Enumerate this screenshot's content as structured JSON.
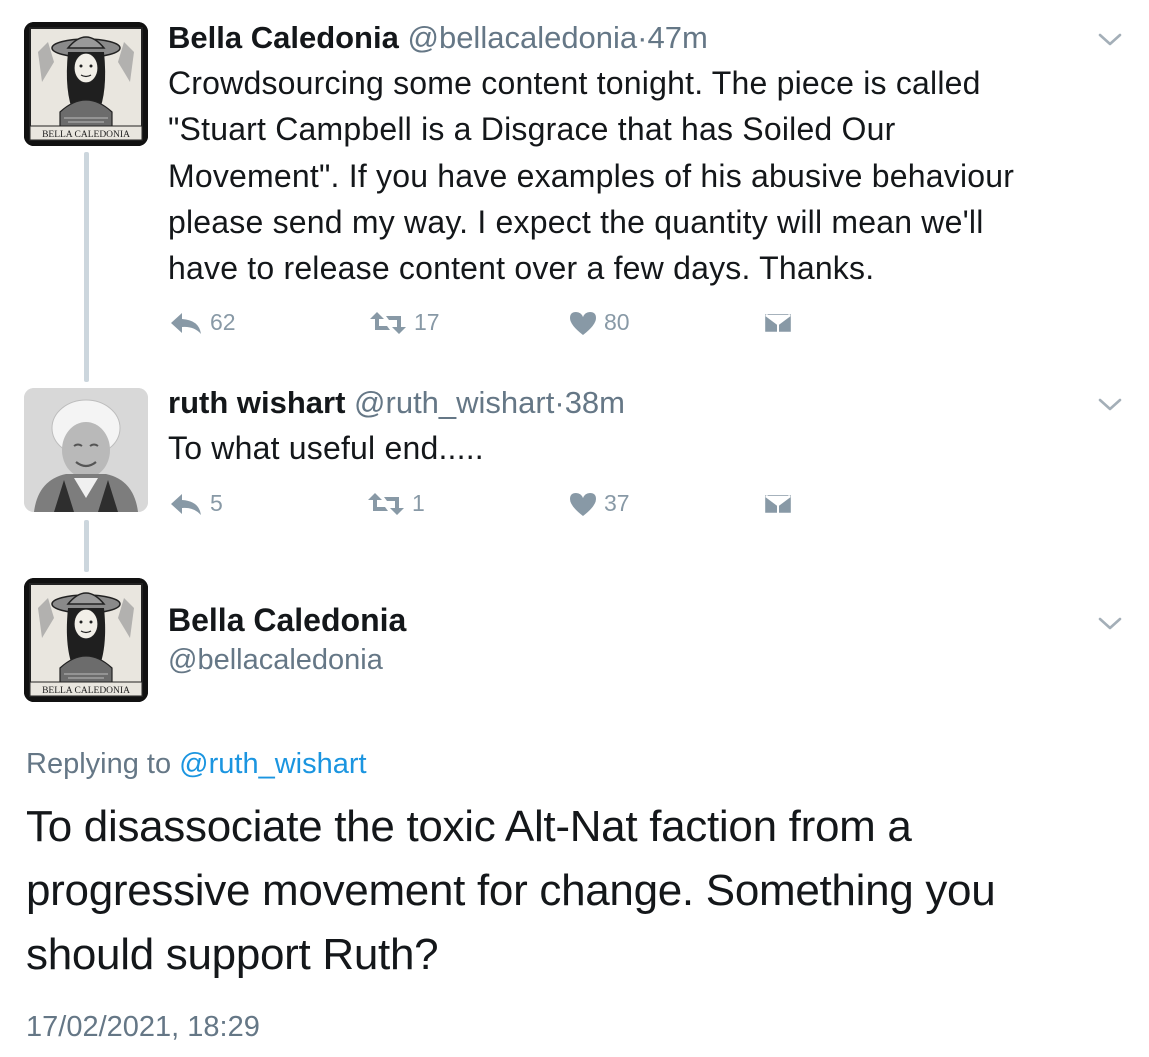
{
  "tweets": [
    {
      "display_name": "Bella Caledonia",
      "handle": "@bellacaledonia",
      "time": "47m",
      "text_lines": [
        "Crowdsourcing some content tonight. The piece is called",
        "\"Stuart Campbell is a Disgrace that has Soiled Our",
        "Movement\". If you have examples of his abusive behaviour",
        "please send my way. I expect the quantity will mean we'll",
        "have to release content over a few days. Thanks."
      ],
      "replies": "62",
      "retweets": "17",
      "likes": "80",
      "avatar_caption": "BELLA CALEDONIA"
    },
    {
      "display_name": "ruth wishart",
      "handle": "@ruth_wishart",
      "time": "38m",
      "text_lines": [
        "To what useful end....."
      ],
      "replies": "5",
      "retweets": "1",
      "likes": "37"
    }
  ],
  "separator": "·",
  "focused": {
    "display_name": "Bella Caledonia",
    "handle": "@bellacaledonia",
    "avatar_caption": "BELLA CALEDONIA",
    "replying_prefix": "Replying to",
    "replying_to": "@ruth_wishart",
    "text_lines": [
      "To disassociate the toxic Alt-Nat faction from a",
      "progressive movement for change. Something you",
      "should support Ruth?"
    ],
    "timestamp": "17/02/2021, 18:29"
  },
  "colors": {
    "text": "#14171a",
    "secondary": "#657786",
    "icon": "#8899a6",
    "link": "#1b95e0",
    "thread_line": "#ccd6dd"
  },
  "icons": [
    "reply-icon",
    "retweet-icon",
    "heart-icon",
    "direct-message-icon",
    "chevron-down-icon"
  ]
}
